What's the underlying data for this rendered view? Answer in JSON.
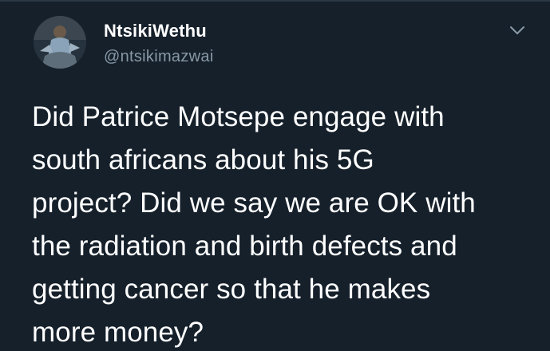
{
  "tweet": {
    "author": {
      "display_name": "NtsikiWethu",
      "handle": "@ntsikimazwai",
      "avatar_icon": "profile-photo"
    },
    "menu_icon": "chevron-down-icon",
    "text": "Did Patrice Motsepe engage with\nsouth africans about his 5G\nproject? Did we say we are OK with\nthe radiation and birth defects and\ngetting cancer so that he makes\nmore money?"
  },
  "colors": {
    "background": "#15202b",
    "primary_text": "#ffffff",
    "secondary_text": "#8899a6"
  }
}
